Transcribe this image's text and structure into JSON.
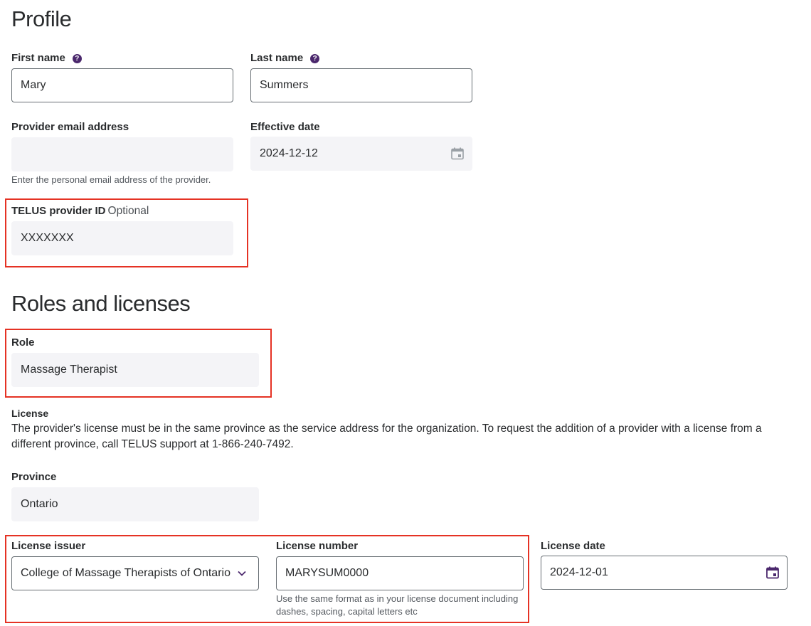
{
  "profile": {
    "heading": "Profile",
    "first_name": {
      "label": "First name",
      "value": "Mary"
    },
    "last_name": {
      "label": "Last name",
      "value": "Summers"
    },
    "email": {
      "label": "Provider email address",
      "value": "",
      "hint": "Enter the personal email address of the provider."
    },
    "effective_date": {
      "label": "Effective date",
      "value": "2024-12-12"
    },
    "telus_id": {
      "label": "TELUS provider ID",
      "optional": "Optional",
      "value": "XXXXXXX"
    }
  },
  "roles": {
    "heading": "Roles and licenses",
    "role": {
      "label": "Role",
      "value": "Massage Therapist"
    },
    "license": {
      "label": "License",
      "description": "The provider's license must be in the same province as the service address for the organization. To request the addition of a provider with a license from a different province, call TELUS support at 1-866-240-7492."
    },
    "province": {
      "label": "Province",
      "value": "Ontario"
    },
    "license_issuer": {
      "label": "License issuer",
      "value": "College of Massage Therapists of Ontario"
    },
    "license_number": {
      "label": "License number",
      "value": "MARYSUM0000",
      "hint": "Use the same format as in your license document including dashes, spacing, capital letters etc"
    },
    "license_date": {
      "label": "License date",
      "value": "2024-12-01"
    }
  },
  "colors": {
    "accent": "#4b286d",
    "highlight_box": "#e53224",
    "readonly_bg": "#f4f4f7"
  },
  "icons": [
    "help-icon",
    "calendar-icon",
    "chevron-down-icon"
  ]
}
